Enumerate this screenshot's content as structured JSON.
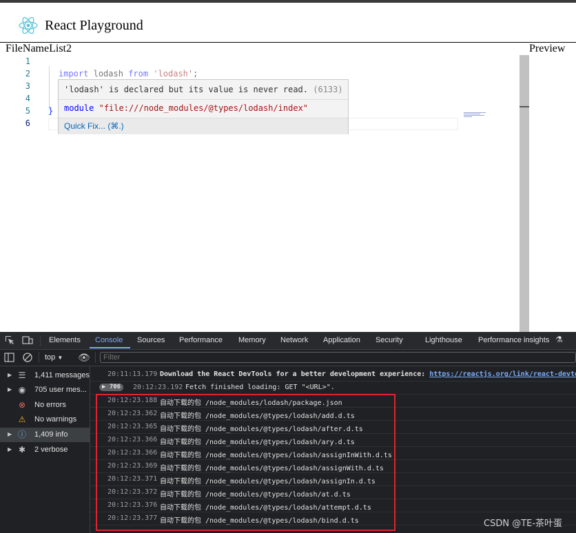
{
  "app": {
    "title": "React Playground",
    "left_pane_label": "FileNameList2",
    "right_pane_label": "Preview"
  },
  "editor": {
    "line_numbers": [
      "1",
      "2",
      "3",
      "4",
      "5",
      "6"
    ],
    "line2": {
      "kw1": "import",
      "ident": "lodash",
      "kw2": "from",
      "str": "'lodash'",
      "semi": ";"
    },
    "line5": "}",
    "hover": {
      "message": "'lodash' is declared but its value is never read.",
      "code": "(6133)",
      "module_kw": "module",
      "module_path": "\"file:///node_modules/@types/lodash/index\"",
      "quick_fix": "Quick Fix... (⌘.)"
    }
  },
  "devtools": {
    "tabs": [
      "Elements",
      "Console",
      "Sources",
      "Performance",
      "Memory",
      "Network",
      "Application",
      "Security",
      "Lighthouse",
      "Performance insights"
    ],
    "active_tab": "Console",
    "context": "top",
    "filter_placeholder": "Filter",
    "sidebar": [
      {
        "label": "1,411 messages",
        "icon": "list-icon"
      },
      {
        "label": "705 user mes...",
        "icon": "user-icon"
      },
      {
        "label": "No errors",
        "icon": "error-icon"
      },
      {
        "label": "No warnings",
        "icon": "warning-icon"
      },
      {
        "label": "1,409 info",
        "icon": "info-icon"
      },
      {
        "label": "2 verbose",
        "icon": "bug-icon"
      }
    ],
    "logs": [
      {
        "time": "20:11:13.179",
        "msg": "Download the React DevTools for a better development experience: ",
        "link": "https://reactjs.org/link/react-devtools"
      },
      {
        "badge": "706",
        "time": "20:12:23.192",
        "msg": "Fetch finished loading: GET \"<URL>\"."
      },
      {
        "time": "20:12:23.188",
        "msg": "自动下载的包 /node_modules/lodash/package.json"
      },
      {
        "time": "20:12:23.362",
        "msg": "自动下载的包 /node_modules/@types/lodash/add.d.ts"
      },
      {
        "time": "20:12:23.365",
        "msg": "自动下载的包 /node_modules/@types/lodash/after.d.ts"
      },
      {
        "time": "20:12:23.366",
        "msg": "自动下载的包 /node_modules/@types/lodash/ary.d.ts"
      },
      {
        "time": "20:12:23.366",
        "msg": "自动下载的包 /node_modules/@types/lodash/assignInWith.d.ts"
      },
      {
        "time": "20:12:23.369",
        "msg": "自动下载的包 /node_modules/@types/lodash/assignWith.d.ts"
      },
      {
        "time": "20:12:23.371",
        "msg": "自动下载的包 /node_modules/@types/lodash/assignIn.d.ts"
      },
      {
        "time": "20:12:23.372",
        "msg": "自动下载的包 /node_modules/@types/lodash/at.d.ts"
      },
      {
        "time": "20:12:23.376",
        "msg": "自动下载的包 /node_modules/@types/lodash/attempt.d.ts"
      },
      {
        "time": "20:12:23.377",
        "msg": "自动下载的包 /node_modules/@types/lodash/bind.d.ts"
      }
    ]
  },
  "watermark": "CSDN @TE-茶叶蛋"
}
